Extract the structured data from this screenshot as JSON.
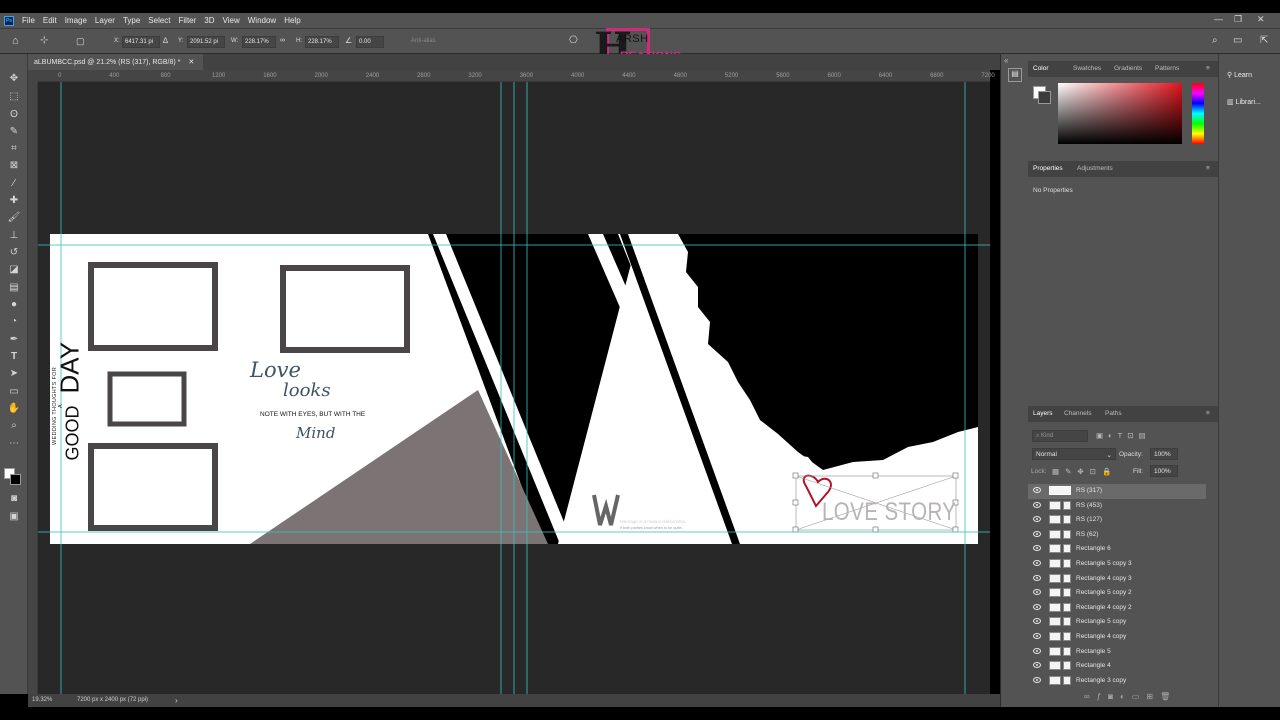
{
  "app": {
    "logo_text": "Ps",
    "menu": [
      "File",
      "Edit",
      "Image",
      "Layer",
      "Type",
      "Select",
      "Filter",
      "3D",
      "View",
      "Window",
      "Help"
    ],
    "window_controls": [
      "—",
      "❐",
      "✕"
    ]
  },
  "options": {
    "x_label": "X:",
    "x_value": "6417.31 pi",
    "y_label": "Y:",
    "y_value": "2091.52 pi",
    "w_label": "W:",
    "w_value": "228.17%",
    "h_label": "H:",
    "h_value": "228.17%",
    "angle_value": "0.00",
    "antialias": "Anti-alias"
  },
  "watermark": {
    "letter": "H",
    "line1": "ARSH",
    "line2": "REATIONS"
  },
  "document": {
    "tab_title": "aLBUMBCC.psd @ 21.2% (RS (317), RGB/8) *",
    "zoom": "19.32%",
    "doc_size": "7200 px x 2400 px (72 ppi)"
  },
  "ruler_ticks": [
    "0",
    "400",
    "800",
    "1200",
    "1600",
    "2000",
    "2400",
    "2800",
    "3200",
    "3600",
    "4000",
    "4400",
    "4800",
    "5200",
    "5600",
    "6000",
    "6400",
    "6800",
    "7200"
  ],
  "artboard": {
    "vertical_text_small": "WEDDING THOUGHTS FOR A",
    "vertical_text_good": "GOOD",
    "vertical_text_day": "DAY",
    "love": "Love",
    "looks": "looks",
    "note": "NOTE WITH EYES, BUT WITH THE",
    "mind": "Mind",
    "wedding": "edding...",
    "wedding_sub": "Marriage is a mutual relationship,",
    "wedding_sub2": "if both parties know when to be quite.",
    "love_story": "LOVE STORY"
  },
  "colors": {
    "accent_magenta": "#d02a7c",
    "guide_cyan": "#35c3c3",
    "frame_gray": "#4a4547",
    "triangle_gray": "#7c7374"
  },
  "color_panel": {
    "tabs": [
      "Color",
      "Swatches",
      "Gradients",
      "Patterns"
    ],
    "active": "Color"
  },
  "properties_panel": {
    "tabs": [
      "Properties",
      "Adjustments"
    ],
    "content": "No Properties"
  },
  "layers_panel": {
    "tabs": [
      "Layers",
      "Channels",
      "Paths"
    ],
    "search_placeholder": "Kind",
    "blend_mode": "Normal",
    "opacity_label": "Opacity:",
    "opacity_value": "100%",
    "lock_label": "Lock:",
    "fill_label": "Fill:",
    "fill_value": "100%",
    "layers": [
      "RS (317)",
      "RS (453)",
      "RS (127)",
      "RS (62)",
      "Rectangle 6",
      "Rectangle 5 copy 3",
      "Rectangle 4 copy 3",
      "Rectangle 5 copy 2",
      "Rectangle 4 copy 2",
      "Rectangle 5 copy",
      "Rectangle 4 copy",
      "Rectangle 5",
      "Rectangle 4",
      "Rectangle 3 copy"
    ]
  },
  "right_col": {
    "learn": "Learn",
    "libraries": "Librari..."
  }
}
